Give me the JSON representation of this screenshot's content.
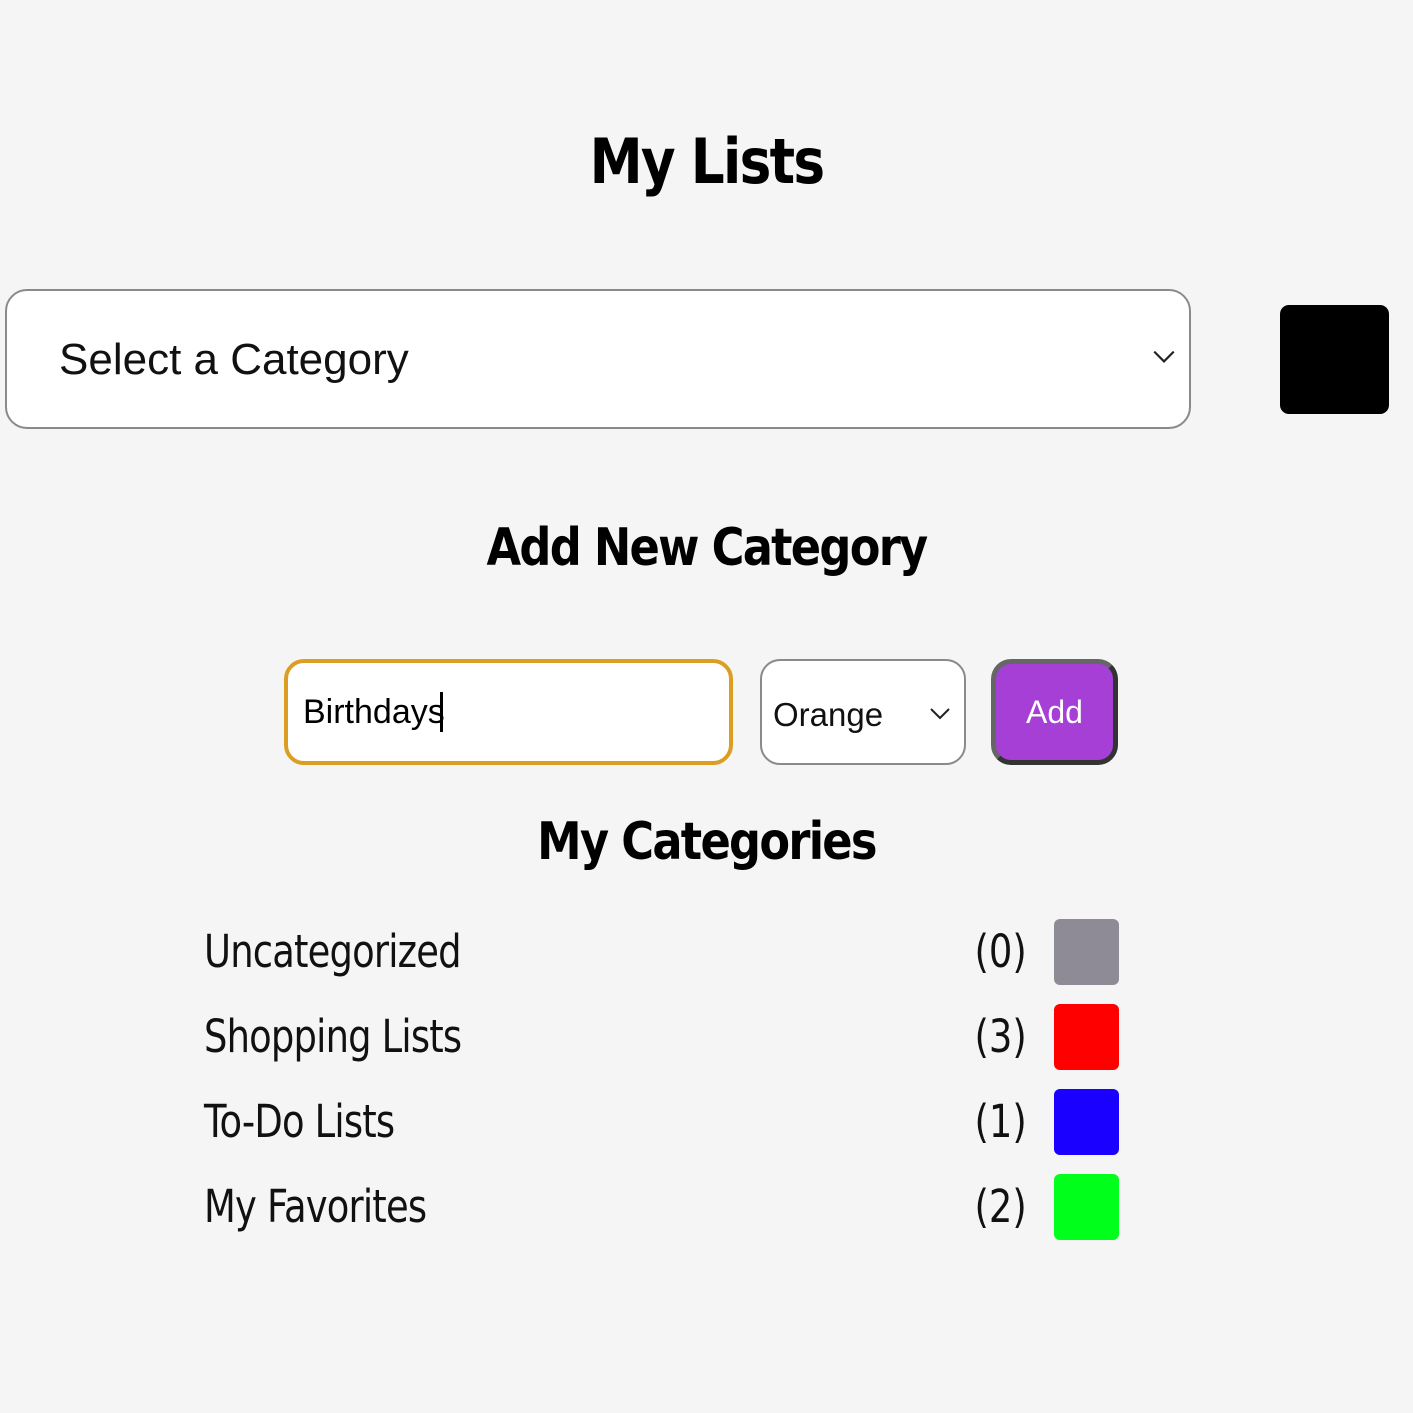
{
  "header": {
    "title": "My Lists"
  },
  "category_select": {
    "selected": "Select a Category"
  },
  "add_section": {
    "title": "Add New Category",
    "name_value": "Birthdays",
    "color_selected": "Orange",
    "add_label": "Add",
    "add_button_color": "#a53fd6"
  },
  "categories_section": {
    "title": "My Categories",
    "items": [
      {
        "name": "Uncategorized",
        "count": "(0)",
        "color": "#8e8b97"
      },
      {
        "name": "Shopping Lists",
        "count": "(3)",
        "color": "#ff0000"
      },
      {
        "name": "To-Do Lists",
        "count": "(1)",
        "color": "#1900ff"
      },
      {
        "name": "My Favorites",
        "count": "(2)",
        "color": "#00ff1a"
      }
    ]
  },
  "icons": {
    "chevron": "chevron-down-icon",
    "black_square": "#000000"
  }
}
